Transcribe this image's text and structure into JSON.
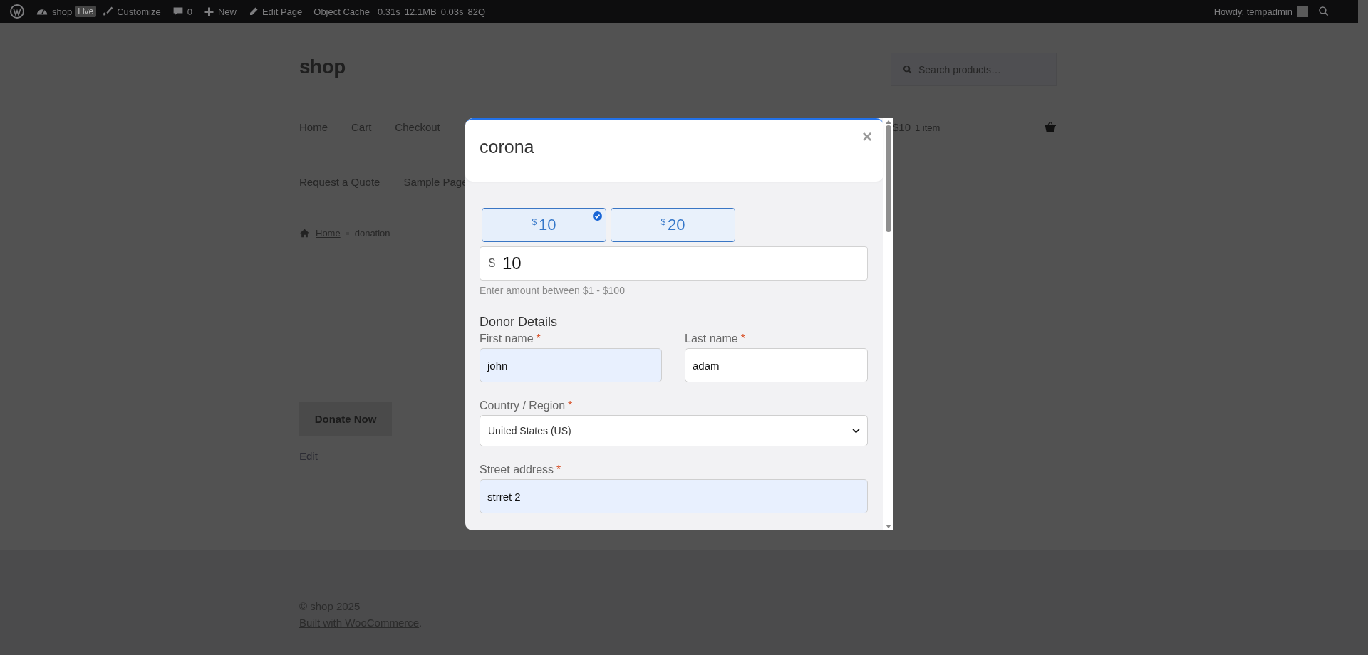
{
  "admin_bar": {
    "items": [
      {
        "kind": "wp-logo"
      },
      {
        "kind": "site",
        "label": "shop"
      },
      {
        "kind": "badge",
        "label": "Live"
      },
      {
        "kind": "customize",
        "label": "Customize"
      },
      {
        "kind": "comments",
        "label": "0"
      },
      {
        "kind": "new",
        "label": "New"
      },
      {
        "kind": "edit",
        "label": "Edit Page"
      },
      {
        "kind": "text",
        "label": "Object Cache"
      },
      {
        "kind": "stat",
        "label": "0.31s"
      },
      {
        "kind": "stat",
        "label": "12.1MB"
      },
      {
        "kind": "stat",
        "label": "0.03s"
      },
      {
        "kind": "stat",
        "label": "82Q"
      }
    ],
    "greeting": "Howdy, tempadmin"
  },
  "site": {
    "title": "shop",
    "search": {
      "placeholder": "Search products…"
    },
    "nav": [
      {
        "label": "Home"
      },
      {
        "label": "Cart"
      },
      {
        "label": "Checkout"
      }
    ],
    "nav_row_2": [
      {
        "label": "Request a Quote"
      },
      {
        "label": "Sample Page"
      }
    ],
    "cart": {
      "amount": "$10",
      "count": "1 item"
    },
    "breadcrumb": [
      {
        "label": "Home",
        "kind": "link"
      },
      {
        "label": "donation",
        "kind": "current"
      }
    ],
    "donate_button": "Donate Now",
    "edit_link": "Edit",
    "footer": {
      "copyright": "© shop 2025",
      "credit_link": "Built with WooCommerce",
      "credit_end": "."
    }
  },
  "modal": {
    "title": "corona",
    "close": "×",
    "amounts": [
      {
        "currency": "$",
        "value": "10",
        "selected": true
      },
      {
        "currency": "$",
        "value": "20",
        "selected": false
      }
    ],
    "amount_field": {
      "currency": "$",
      "value": "10"
    },
    "hint": "Enter amount between $1 - $100",
    "section": "Donor Details",
    "fields": [
      {
        "kind": "input",
        "label": "First name",
        "required_mark": "*",
        "value": "john",
        "autofilled": true,
        "half": true
      },
      {
        "kind": "input",
        "label": "Last name",
        "required_mark": "*",
        "value": "adam",
        "autofilled": false,
        "half": true
      },
      {
        "kind": "select",
        "label": "Country / Region",
        "required_mark": "*",
        "value": "United States (US)",
        "autofilled": false,
        "half": false
      },
      {
        "kind": "input",
        "label": "Street address",
        "required_mark": "*",
        "value": "strret 2",
        "autofilled": true,
        "half": false
      }
    ]
  }
}
